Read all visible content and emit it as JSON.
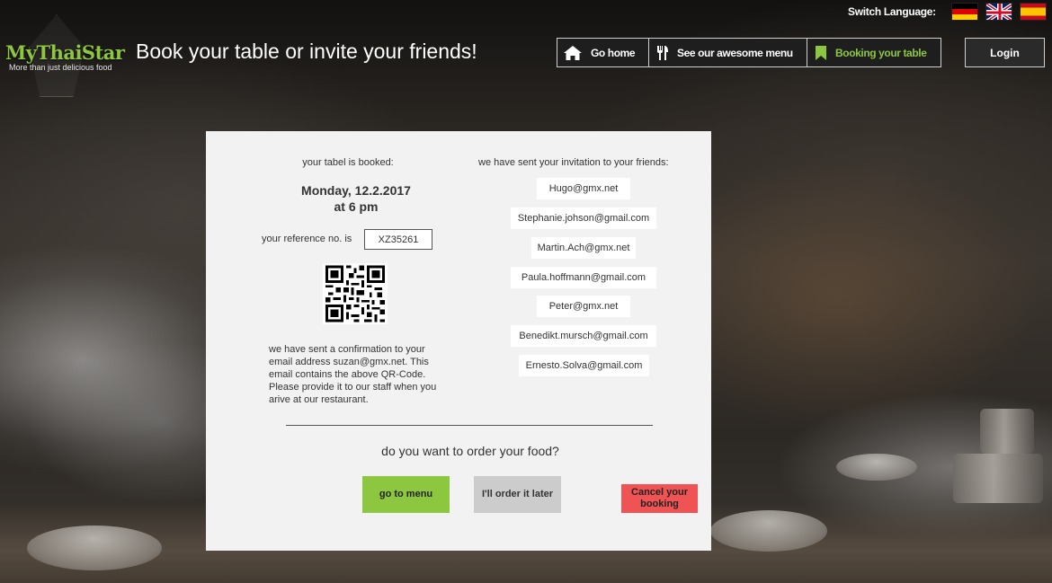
{
  "header": {
    "logo_name": "MyThaiStar",
    "logo_tagline": "More than just delicious food",
    "page_title": "Book your table or invite your friends!",
    "switch_language_label": "Switch Language:",
    "languages": [
      "German",
      "English",
      "Spanish"
    ],
    "nav": {
      "home": "Go home",
      "menu": "See our awesome menu",
      "booking": "Booking your table"
    },
    "login": "Login",
    "accent_color": "#8dc63f"
  },
  "booking": {
    "booked_label": "your tabel is booked:",
    "date": "Monday, 12.2.2017",
    "time": "at 6 pm",
    "reference_label": "your reference no. is",
    "reference_number": "XZ35261",
    "confirmation_text": "we have sent a confirmation to your email address  suzan@gmx.net. This email contains the above QR-Code. Please provide it to our staff when you arive at our restaurant."
  },
  "invitations": {
    "label": "we have sent your invitation to your friends:",
    "emails": [
      "Hugo@gmx.net",
      "Stephanie.johson@gmail.com",
      "Martin.Ach@gmx.net",
      "Paula.hoffmann@gmail.com",
      "Peter@gmx.net",
      "Benedikt.mursch@gmail.com",
      "Ernesto.Solva@gmail.com"
    ]
  },
  "order": {
    "question": "do you want to order your food?",
    "go_to_menu": "go to menu",
    "order_later": "I'll order it later",
    "cancel_booking": "Cancel your booking",
    "colors": {
      "primary": "#8dc63f",
      "secondary": "#cccccc",
      "danger": "#f05353"
    }
  }
}
